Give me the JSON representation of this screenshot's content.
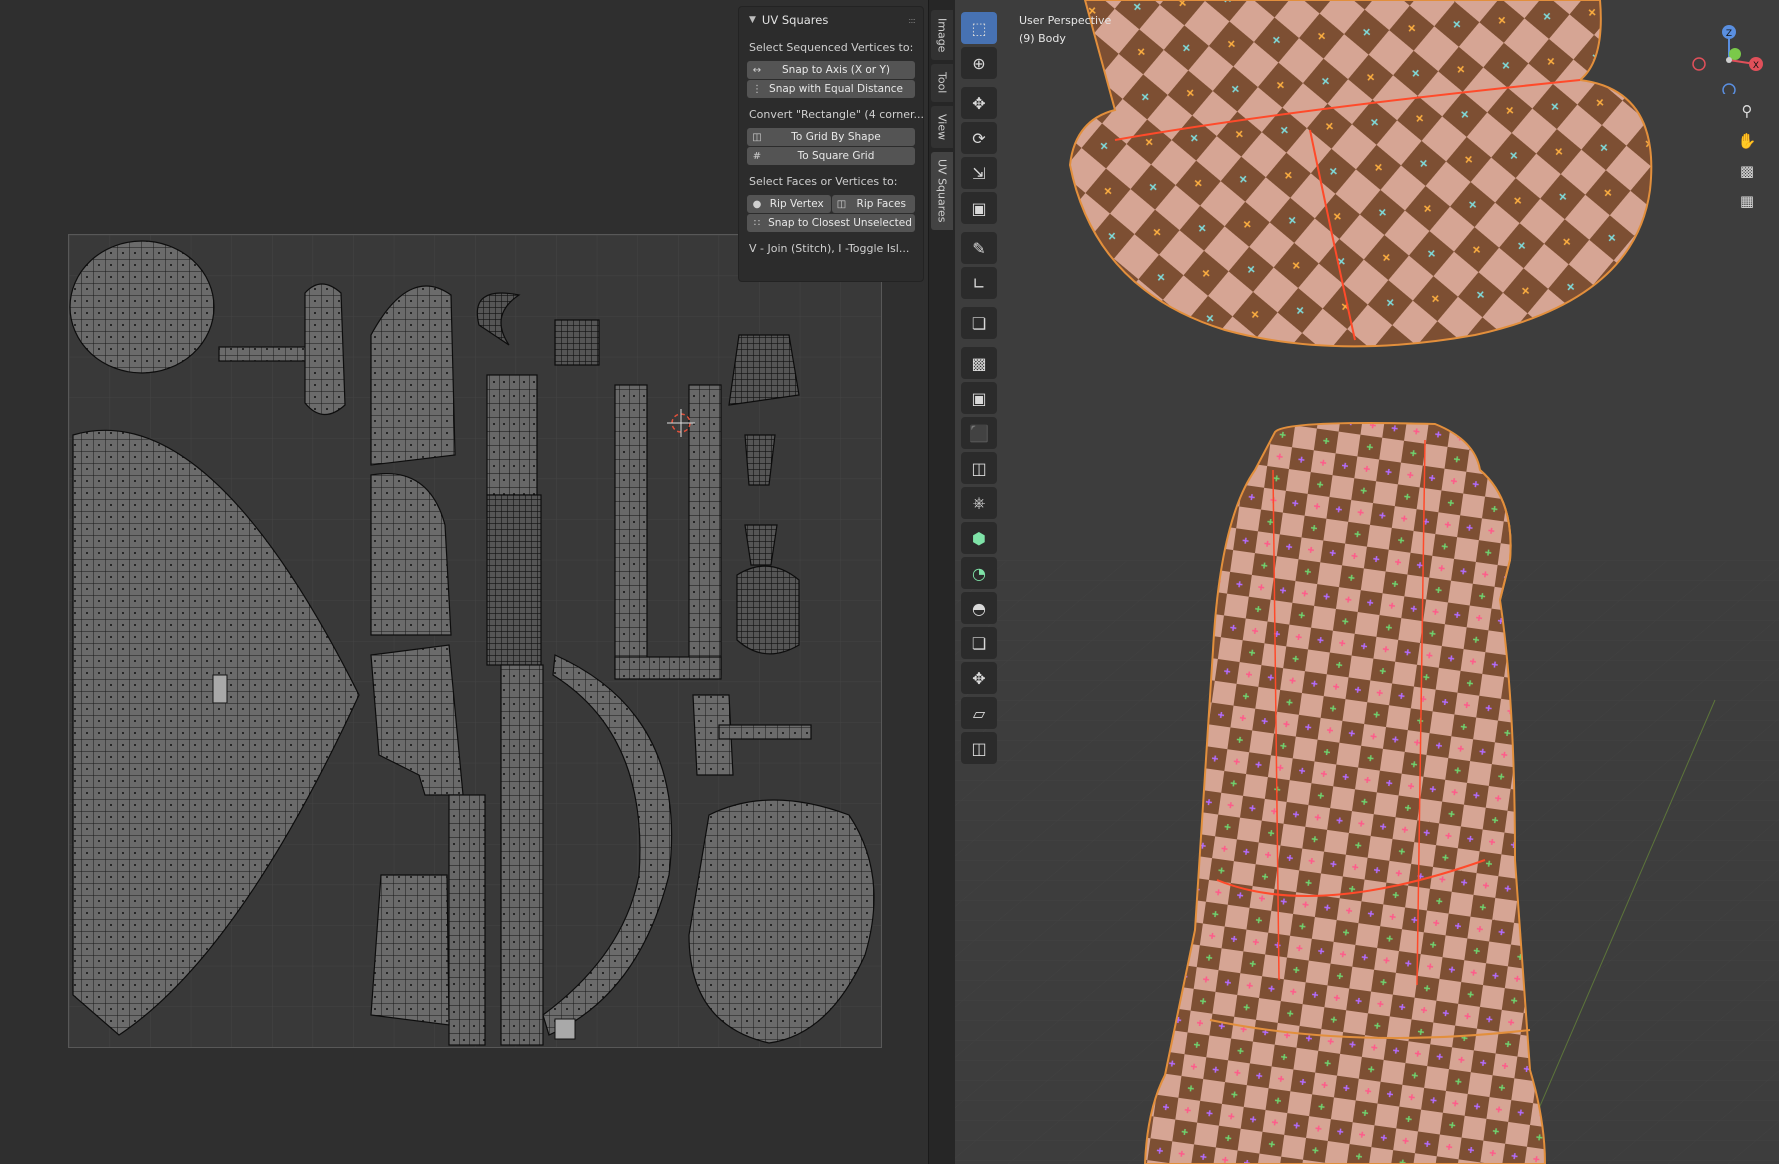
{
  "uv_panel": {
    "title": "UV Squares",
    "section1_label": "Select Sequenced Vertices to:",
    "btn_snap_axis": "Snap to Axis (X or Y)",
    "btn_snap_equal": "Snap with Equal Distance",
    "section2_label": "Convert \"Rectangle\" (4 corner...",
    "btn_grid_shape": "To Grid By Shape",
    "btn_square_grid": "To Square Grid",
    "section3_label": "Select Faces or Vertices to:",
    "btn_rip_vertex": "Rip Vertex",
    "btn_rip_faces": "Rip Faces",
    "btn_snap_closest": "Snap to Closest Unselected",
    "hint": "V - Join (Stitch), I -Toggle Isl..."
  },
  "sidebar_tabs": [
    "Image",
    "Tool",
    "View",
    "UV Squares"
  ],
  "viewport": {
    "perspective": "User Perspective",
    "object": "(9) Body"
  },
  "gizmo": {
    "z_label": "Z",
    "x_label": "X"
  },
  "colors": {
    "checker_light": "#d6a594",
    "checker_dark": "#7d4f33",
    "wire": "#e28f3c",
    "selected_seam": "#ff4a2a",
    "active_tool": "#4772b3"
  },
  "icons": {
    "tools": [
      "select-box-icon",
      "cursor-icon",
      "move-icon",
      "rotate-icon",
      "scale-icon",
      "transform-icon",
      "annotate-icon",
      "measure-icon",
      "add-cube-icon",
      "extrude-icon",
      "inset-icon",
      "bevel-icon",
      "loop-cut-icon",
      "knife-icon",
      "poly-build-icon",
      "spin-icon",
      "smooth-icon",
      "edge-slide-icon",
      "shrink-fatten-icon",
      "shear-icon",
      "rip-region-icon"
    ],
    "nav": [
      "zoom-icon",
      "pan-hand-icon",
      "camera-icon",
      "grid-view-icon"
    ]
  }
}
